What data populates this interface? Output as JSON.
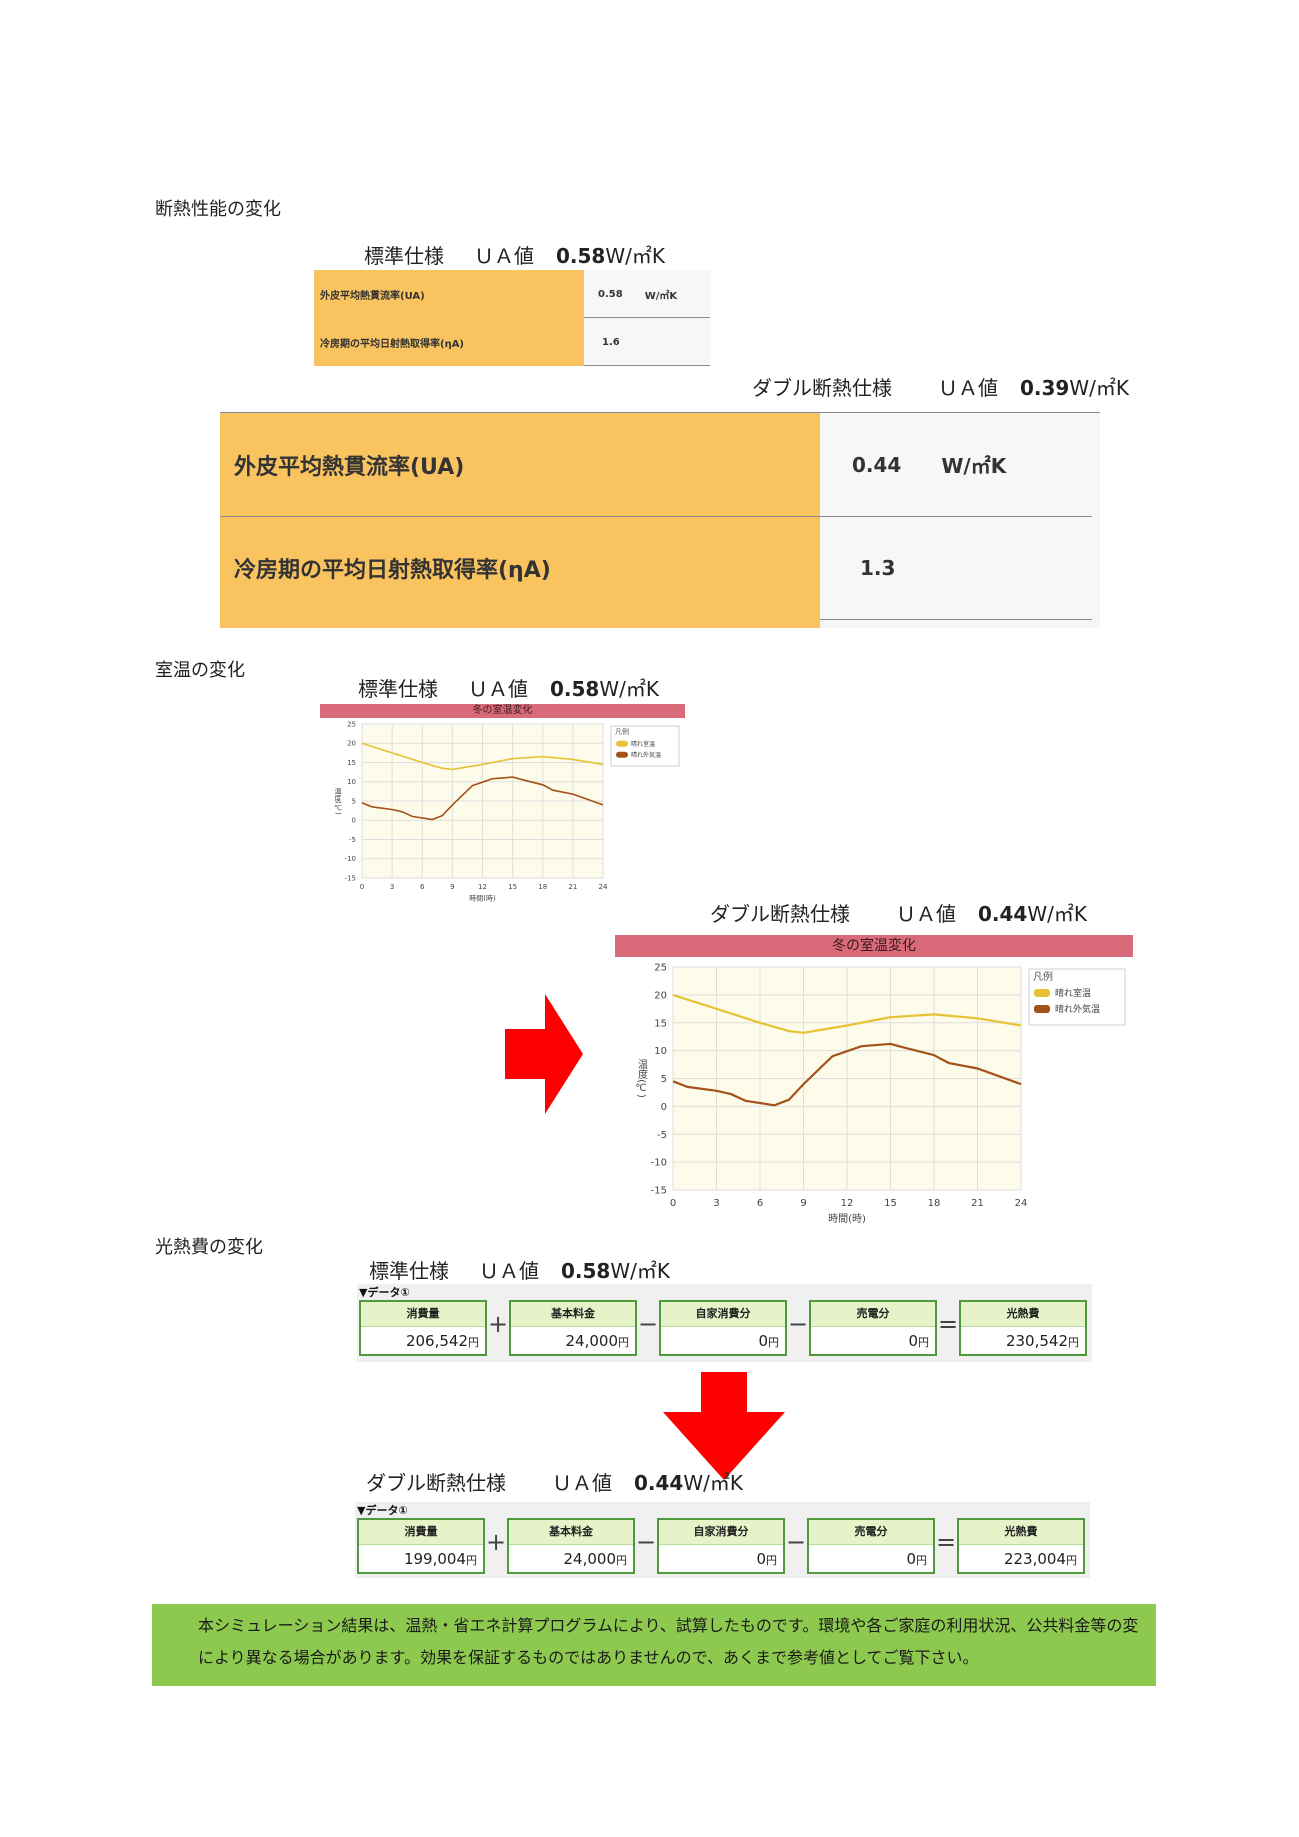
{
  "sections": {
    "insulation_title": "断熱性能の変化",
    "roomtemp_title": "室温の変化",
    "cost_title": "光熱費の変化"
  },
  "specs": {
    "standard": {
      "name": "標準仕様",
      "ua_label": "ＵＡ値",
      "ua_value": "0.58",
      "unit": "W/㎡K"
    },
    "double_a": {
      "name": "ダブル断熱仕様",
      "ua_label": "ＵＡ値",
      "ua_value": "0.39",
      "unit": "W/㎡K"
    },
    "double_b": {
      "name": "ダブル断熱仕様",
      "ua_label": "ＵＡ値",
      "ua_value": "0.44",
      "unit": "W/㎡K"
    }
  },
  "ua_tables": {
    "standard": {
      "rows": [
        {
          "label": "外皮平均熱貫流率(UA)",
          "value": "0.58",
          "unit": "W/㎡K"
        },
        {
          "label": "冷房期の平均日射熱取得率(ηA)",
          "value": "1.6",
          "unit": ""
        }
      ]
    },
    "double": {
      "rows": [
        {
          "label": "外皮平均熱貫流率(UA)",
          "value": "0.44",
          "unit": "W/㎡K"
        },
        {
          "label": "冷房期の平均日射熱取得率(ηA)",
          "value": "1.3",
          "unit": ""
        }
      ]
    }
  },
  "chart_data": [
    {
      "type": "line",
      "title": "冬の室温変化",
      "xlabel": "時間(時)",
      "ylabel": "温度(℃)",
      "x": [
        0,
        3,
        6,
        9,
        12,
        15,
        18,
        21,
        24
      ],
      "xlim": [
        0,
        24
      ],
      "ylim": [
        -15,
        25
      ],
      "yticks": [
        25,
        20,
        15,
        10,
        5,
        0,
        -5,
        -10,
        -15
      ],
      "legend_title": "凡例",
      "legend_position": "top-right",
      "grid": true,
      "series": [
        {
          "name": "晴れ室温",
          "color": "#e6c235",
          "points": [
            [
              0,
              20
            ],
            [
              3,
              17.5
            ],
            [
              6,
              15
            ],
            [
              8,
              13.5
            ],
            [
              9,
              13.2
            ],
            [
              12,
              14.5
            ],
            [
              15,
              16
            ],
            [
              18,
              16.5
            ],
            [
              21,
              15.8
            ],
            [
              24,
              14.5
            ]
          ]
        },
        {
          "name": "晴れ外気温",
          "color": "#a3521a",
          "points": [
            [
              0,
              4.5
            ],
            [
              1,
              3.5
            ],
            [
              3,
              2.8
            ],
            [
              4,
              2.2
            ],
            [
              5,
              1
            ],
            [
              7,
              0.2
            ],
            [
              8,
              1.2
            ],
            [
              9,
              4
            ],
            [
              11,
              9
            ],
            [
              13,
              10.8
            ],
            [
              15,
              11.2
            ],
            [
              16,
              10.5
            ],
            [
              18,
              9.2
            ],
            [
              19,
              7.8
            ],
            [
              21,
              6.8
            ],
            [
              24,
              4
            ]
          ]
        }
      ]
    },
    {
      "type": "line",
      "title": "冬の室温変化",
      "xlabel": "時間(時)",
      "ylabel": "温度(℃)",
      "x": [
        0,
        3,
        6,
        9,
        12,
        15,
        18,
        21,
        24
      ],
      "xlim": [
        0,
        24
      ],
      "ylim": [
        -15,
        25
      ],
      "yticks": [
        25,
        20,
        15,
        10,
        5,
        0,
        -5,
        -10,
        -15
      ],
      "legend_title": "凡例",
      "legend_position": "top-right",
      "grid": true,
      "series": [
        {
          "name": "晴れ室温",
          "color": "#e6c235",
          "points": [
            [
              0,
              20
            ],
            [
              3,
              17.5
            ],
            [
              6,
              15
            ],
            [
              8,
              13.5
            ],
            [
              9,
              13.2
            ],
            [
              12,
              14.5
            ],
            [
              15,
              16
            ],
            [
              18,
              16.5
            ],
            [
              21,
              15.8
            ],
            [
              24,
              14.5
            ]
          ]
        },
        {
          "name": "晴れ外気温",
          "color": "#a3521a",
          "points": [
            [
              0,
              4.5
            ],
            [
              1,
              3.5
            ],
            [
              3,
              2.8
            ],
            [
              4,
              2.2
            ],
            [
              5,
              1
            ],
            [
              7,
              0.2
            ],
            [
              8,
              1.2
            ],
            [
              9,
              4
            ],
            [
              11,
              9
            ],
            [
              13,
              10.8
            ],
            [
              15,
              11.2
            ],
            [
              16,
              10.5
            ],
            [
              18,
              9.2
            ],
            [
              19,
              7.8
            ],
            [
              21,
              6.8
            ],
            [
              24,
              4
            ]
          ]
        }
      ]
    }
  ],
  "cost": {
    "header": "▼データ①",
    "ops": [
      "+",
      "−",
      "−",
      "="
    ],
    "yen": "円",
    "standard": [
      {
        "label": "消費量",
        "value": "206,542"
      },
      {
        "label": "基本料金",
        "value": "24,000"
      },
      {
        "label": "自家消費分",
        "value": "0"
      },
      {
        "label": "売電分",
        "value": "0"
      },
      {
        "label": "光熱費",
        "value": "230,542"
      }
    ],
    "double": [
      {
        "label": "消費量",
        "value": "199,004"
      },
      {
        "label": "基本料金",
        "value": "24,000"
      },
      {
        "label": "自家消費分",
        "value": "0"
      },
      {
        "label": "売電分",
        "value": "0"
      },
      {
        "label": "光熱費",
        "value": "223,004"
      }
    ]
  },
  "note": {
    "line1": "本シミュレーション結果は、温熱・省エネ計算プログラムにより、試算したものです。環境や各ご家庭の利用状況、公共料金等の変",
    "line2": "により異なる場合があります。効果を保証するものではありませんので、あくまで参考値としてご覧下さい。"
  },
  "colors": {
    "arrow": "#ff0000",
    "table_label": "#f9c460",
    "chart_bar": "#d96a79",
    "cost_border": "#4f9a3c",
    "note_bg": "#8dc94e"
  }
}
